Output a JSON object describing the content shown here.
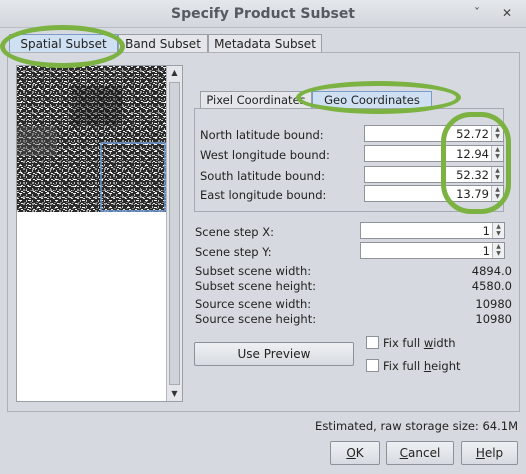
{
  "window": {
    "title": "Specify Product Subset",
    "chevron_label": "ˇ",
    "close_label": "✕"
  },
  "tabs": [
    "Spatial Subset",
    "Band Subset",
    "Metadata Subset"
  ],
  "subtabs": [
    "Pixel Coordinates",
    "Geo Coordinates"
  ],
  "geo": {
    "north": {
      "label": "North latitude bound:",
      "value": "52.72"
    },
    "west": {
      "label": "West longitude bound:",
      "value": "12.94"
    },
    "south": {
      "label": "South latitude bound:",
      "value": "52.32"
    },
    "east": {
      "label": "East longitude bound:",
      "value": "13.79"
    }
  },
  "scene_step": {
    "x": {
      "label": "Scene step X:",
      "value": "1"
    },
    "y": {
      "label": "Scene step Y:",
      "value": "1"
    }
  },
  "info": [
    {
      "label": "Subset scene width:",
      "value": "4894.0"
    },
    {
      "label": "Subset scene height:",
      "value": "4580.0"
    },
    {
      "label": "Source scene width:",
      "value": "10980"
    },
    {
      "label": "Source scene height:",
      "value": "10980"
    }
  ],
  "use_preview": "Use Preview",
  "fix_width": {
    "pre": "Fix full ",
    "key": "w",
    "post": "idth"
  },
  "fix_height": {
    "pre": "Fix full ",
    "key": "h",
    "post": "eight"
  },
  "storage": "Estimated, raw storage size: 64.1M",
  "buttons": {
    "ok": {
      "key": "O",
      "rest": "K"
    },
    "cancel": {
      "pre": "",
      "key": "C",
      "rest": "ancel"
    },
    "help": {
      "key": "H",
      "rest": "elp"
    }
  },
  "colors": {
    "highlight": "#7bb241",
    "selection": "#6f9ad8"
  }
}
